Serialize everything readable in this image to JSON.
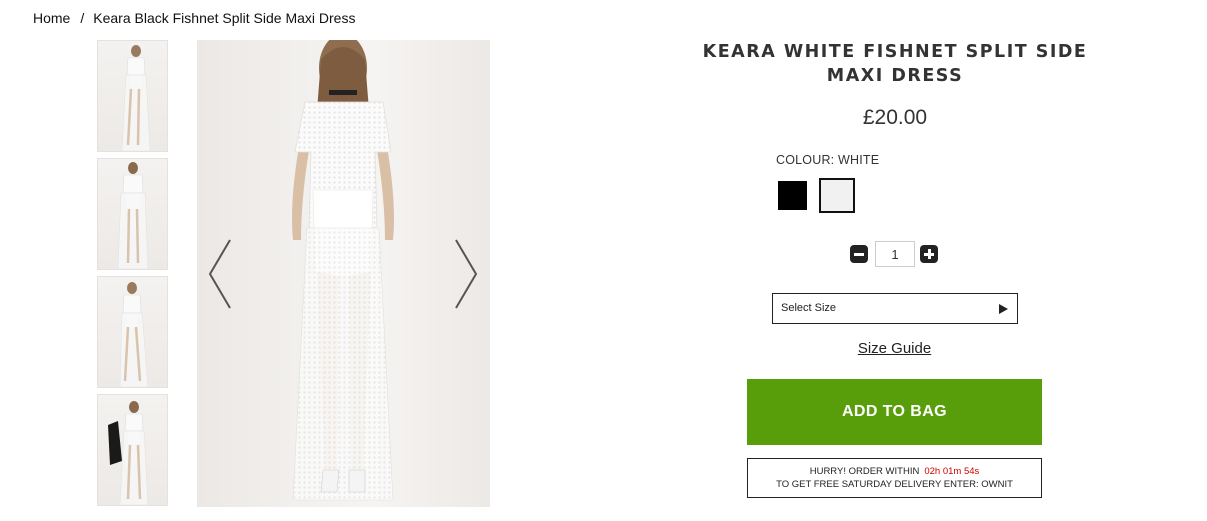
{
  "breadcrumb": {
    "home": "Home",
    "separator": "/",
    "current": "Keara Black Fishnet Split Side Maxi Dress"
  },
  "gallery": {
    "thumbnails": [
      "product-thumbnail",
      "product-thumbnail",
      "product-thumbnail",
      "product-thumbnail"
    ],
    "prev_icon": "chevron-left-icon",
    "next_icon": "chevron-right-icon"
  },
  "product": {
    "title": "KEARA WHITE FISHNET SPLIT SIDE MAXI DRESS",
    "price": "£20.00",
    "colour_label": "COLOUR: WHITE",
    "colours": [
      {
        "name": "black",
        "hex": "#000000",
        "selected": false
      },
      {
        "name": "white",
        "hex": "#f1f1f1",
        "selected": true
      }
    ],
    "quantity": "1",
    "size_select": "Select Size",
    "size_guide": "Size Guide",
    "add_to_bag": "ADD TO BAG",
    "promo": {
      "line1": "HURRY! ORDER WITHIN",
      "timer": "02h 01m 54s",
      "line2": "TO GET FREE SATURDAY DELIVERY ENTER: OWNIT"
    }
  },
  "colors": {
    "add_to_bag_bg": "#589e0b",
    "timer_text": "#d00000"
  }
}
